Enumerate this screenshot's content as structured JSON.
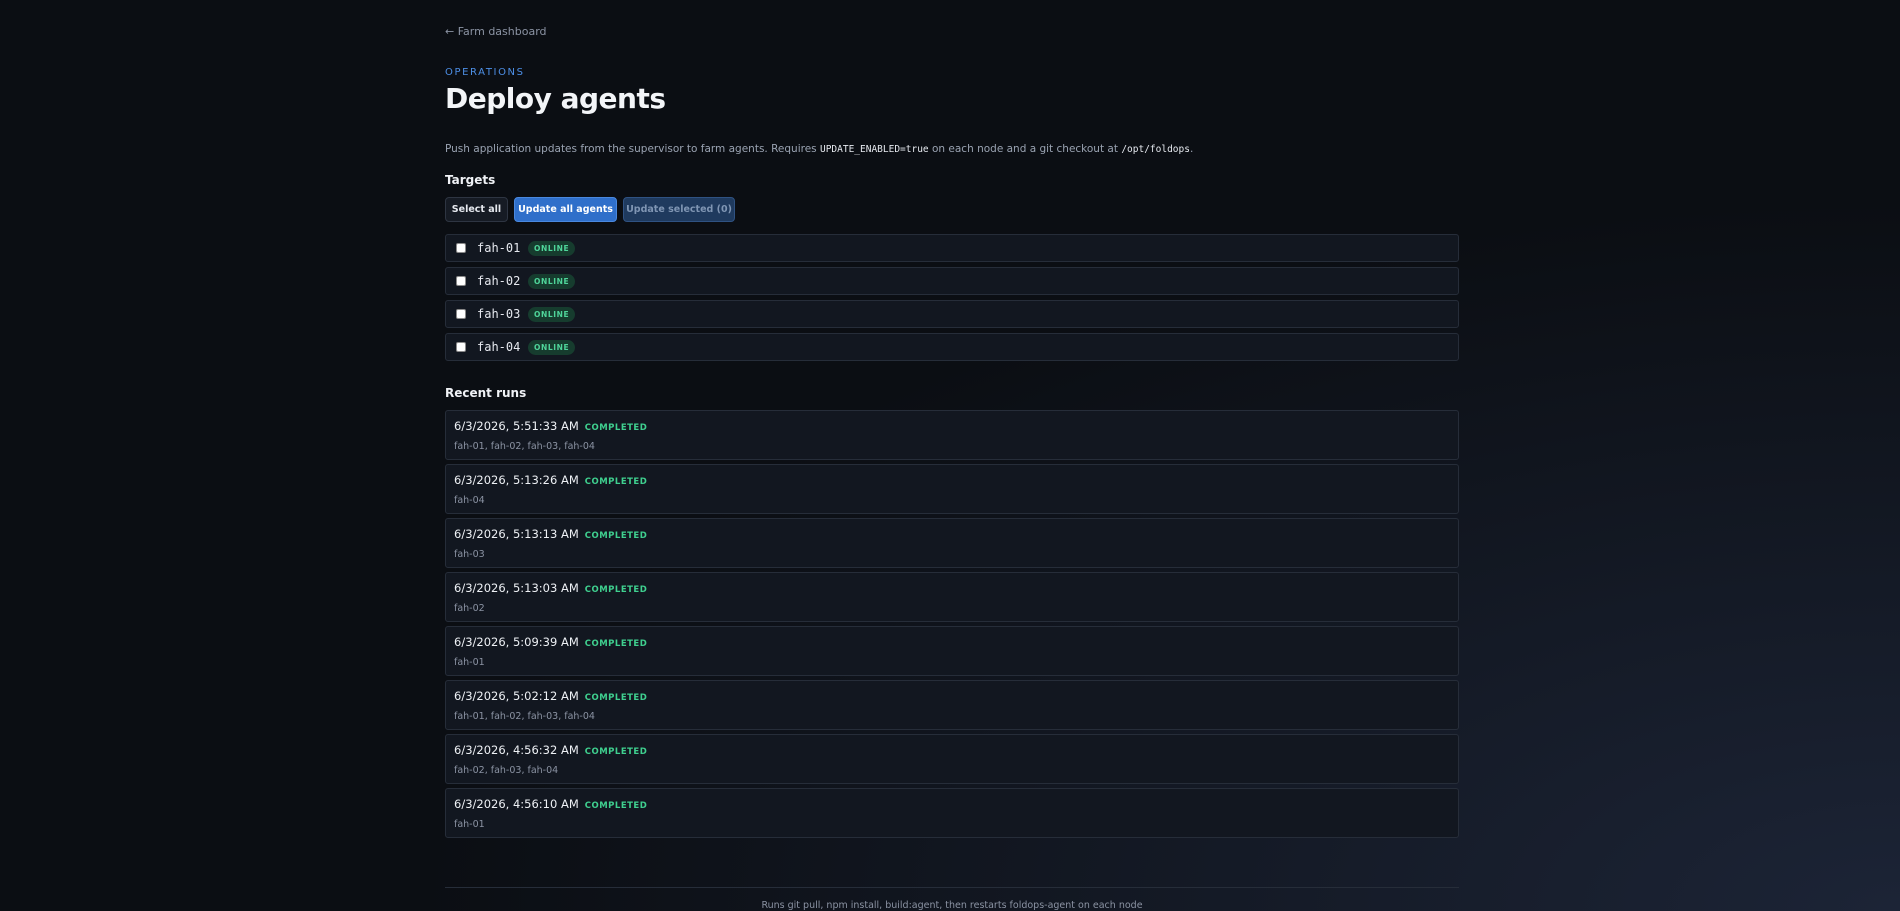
{
  "nav": {
    "back_link": "← Farm dashboard"
  },
  "header": {
    "eyebrow": "OPERATIONS",
    "title": "Deploy agents",
    "description_pre": "Push application updates from the supervisor to farm agents. Requires ",
    "description_code1": "UPDATE_ENABLED=true",
    "description_mid": " on each node and a git checkout at ",
    "description_code2": "/opt/foldops",
    "description_post": "."
  },
  "targets": {
    "title": "Targets",
    "buttons": {
      "select_all": "Select all",
      "update_all": "Update all agents",
      "update_selected": "Update selected (0)"
    },
    "items": [
      {
        "name": "fah-01",
        "status": "ONLINE",
        "checked": false
      },
      {
        "name": "fah-02",
        "status": "ONLINE",
        "checked": false
      },
      {
        "name": "fah-03",
        "status": "ONLINE",
        "checked": false
      },
      {
        "name": "fah-04",
        "status": "ONLINE",
        "checked": false
      }
    ]
  },
  "runs": {
    "title": "Recent runs",
    "items": [
      {
        "time": "6/3/2026, 5:51:33 AM",
        "status": "COMPLETED",
        "targets": "fah-01, fah-02, fah-03, fah-04"
      },
      {
        "time": "6/3/2026, 5:13:26 AM",
        "status": "COMPLETED",
        "targets": "fah-04"
      },
      {
        "time": "6/3/2026, 5:13:13 AM",
        "status": "COMPLETED",
        "targets": "fah-03"
      },
      {
        "time": "6/3/2026, 5:13:03 AM",
        "status": "COMPLETED",
        "targets": "fah-02"
      },
      {
        "time": "6/3/2026, 5:09:39 AM",
        "status": "COMPLETED",
        "targets": "fah-01"
      },
      {
        "time": "6/3/2026, 5:02:12 AM",
        "status": "COMPLETED",
        "targets": "fah-01, fah-02, fah-03, fah-04"
      },
      {
        "time": "6/3/2026, 4:56:32 AM",
        "status": "COMPLETED",
        "targets": "fah-02, fah-03, fah-04"
      },
      {
        "time": "6/3/2026, 4:56:10 AM",
        "status": "COMPLETED",
        "targets": "fah-01"
      }
    ]
  },
  "footer": {
    "text": "Runs git pull, npm install, build:agent, then restarts foldops-agent on each node"
  },
  "colors": {
    "accent": "#2f6fca",
    "online": "#4fd59a",
    "completed": "#3fd08f",
    "background": "#0b0e13"
  }
}
